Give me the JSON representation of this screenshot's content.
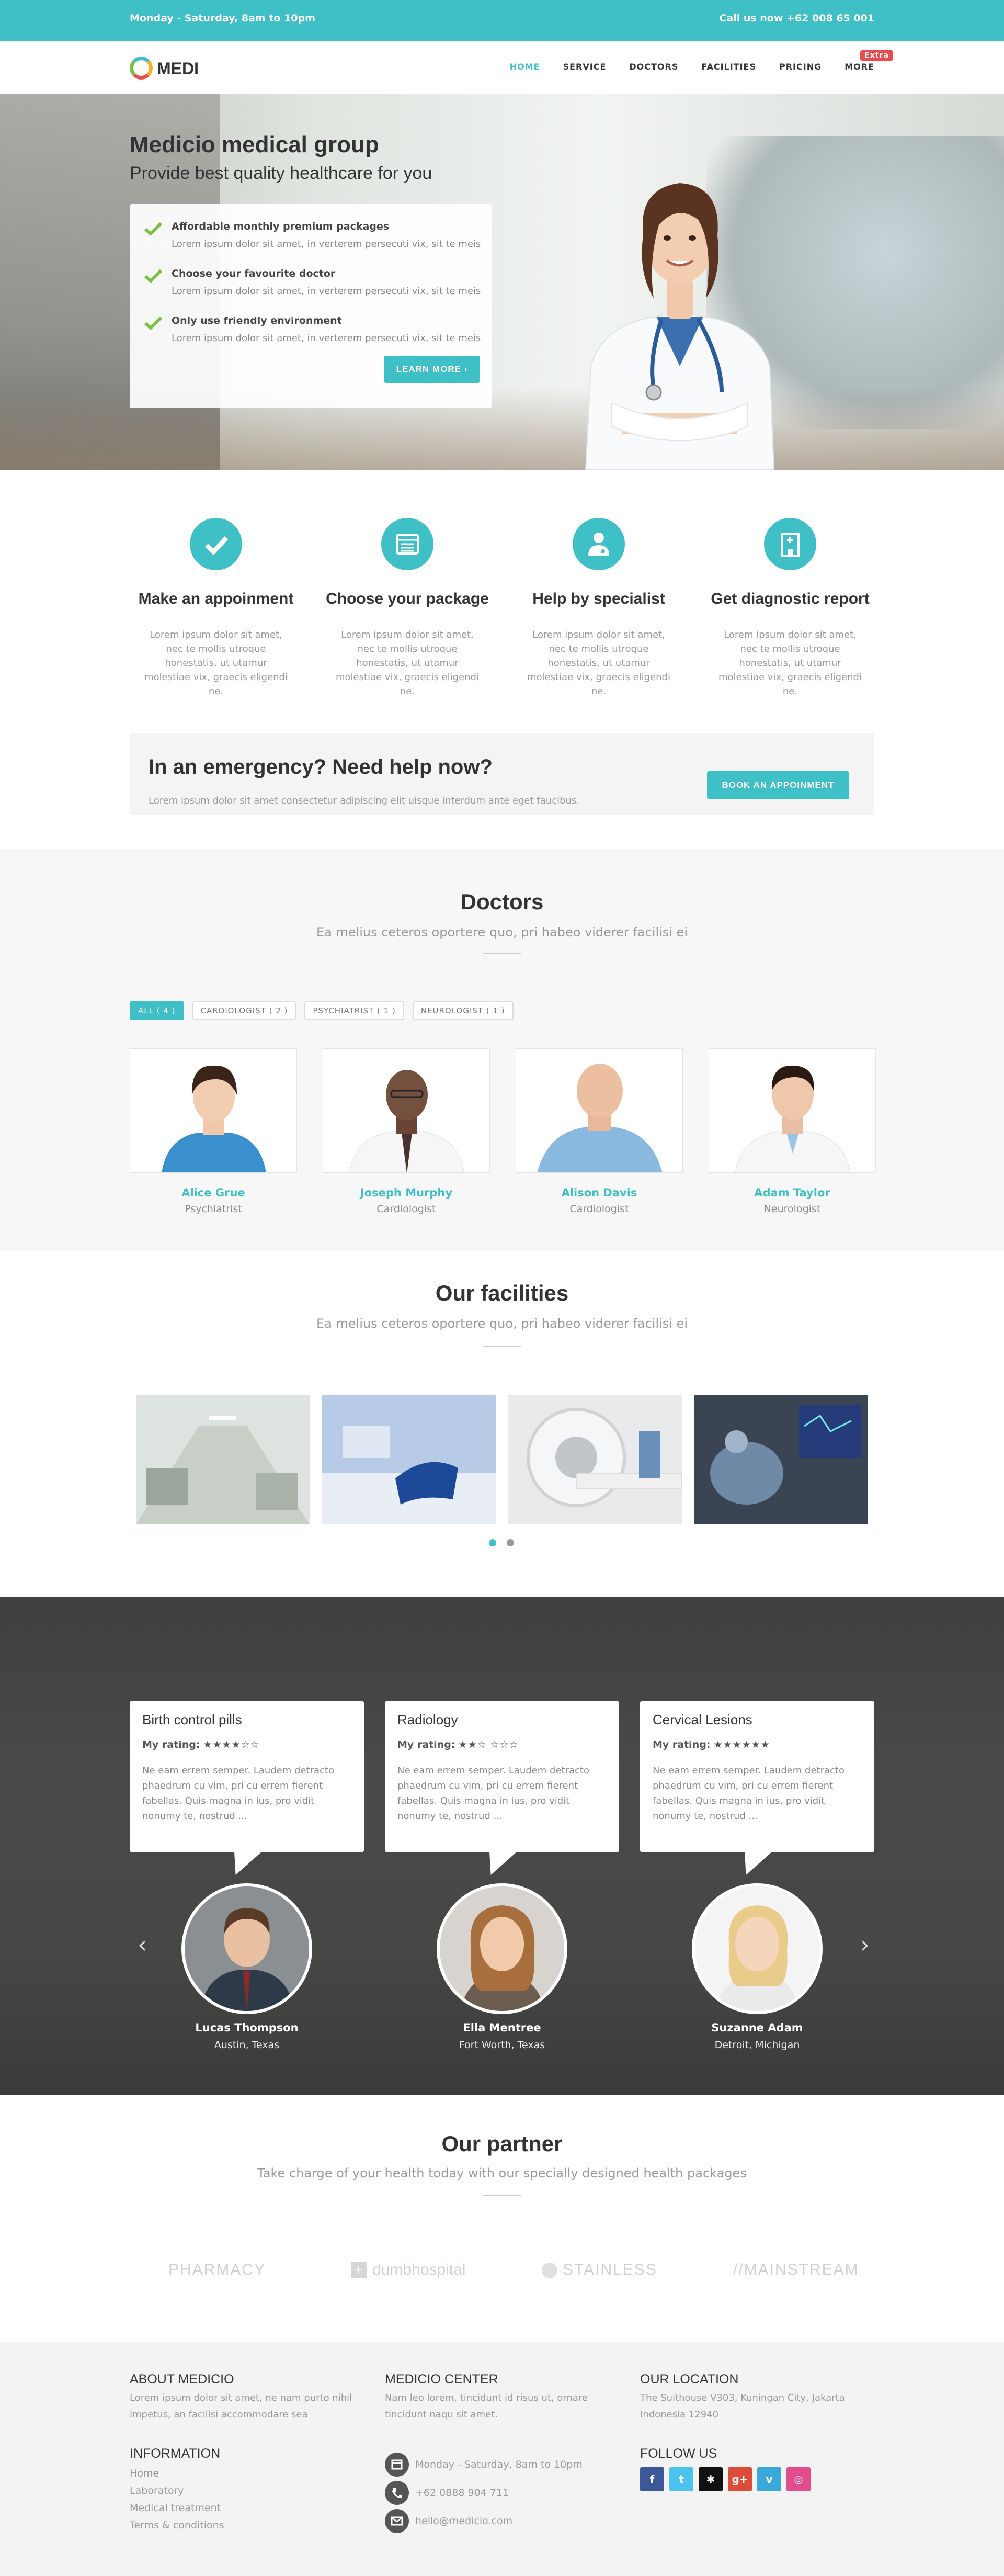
{
  "topbar": {
    "hours": "Monday - Saturday, 8am to 10pm",
    "call": "Call us now +62 008 65 001"
  },
  "nav": {
    "logo": "MEDI",
    "items": [
      "HOME",
      "SERVICE",
      "DOCTORS",
      "FACILITIES",
      "PRICING",
      "MORE"
    ],
    "badge": "Extra"
  },
  "hero": {
    "title": "Medicio medical group",
    "subtitle": "Provide best quality healthcare for you",
    "items": [
      {
        "title": "Affordable monthly premium packages",
        "desc": "Lorem ipsum dolor sit amet, in verterem persecuti vix, sit te meis"
      },
      {
        "title": "Choose your favourite doctor",
        "desc": "Lorem ipsum dolor sit amet, in verterem persecuti vix, sit te meis"
      },
      {
        "title": "Only use friendly environment",
        "desc": "Lorem ipsum dolor sit amet, in verterem persecuti vix, sit te meis"
      }
    ],
    "button": "LEARN MORE ›"
  },
  "features": [
    {
      "icon": "check-icon",
      "title": "Make an appoinment",
      "desc": "Lorem ipsum dolor sit amet, nec te mollis utroque honestatis, ut utamur molestiae vix, graecis eligendi ne."
    },
    {
      "icon": "list-icon",
      "title": "Choose your package",
      "desc": "Lorem ipsum dolor sit amet, nec te mollis utroque honestatis, ut utamur molestiae vix, graecis eligendi ne."
    },
    {
      "icon": "doctor-icon",
      "title": "Help by specialist",
      "desc": "Lorem ipsum dolor sit amet, nec te mollis utroque honestatis, ut utamur molestiae vix, graecis eligendi ne."
    },
    {
      "icon": "hospital-icon",
      "title": "Get diagnostic report",
      "desc": "Lorem ipsum dolor sit amet, nec te mollis utroque honestatis, ut utamur molestiae vix, graecis eligendi ne."
    }
  ],
  "emergency": {
    "title": "In an emergency? Need help now?",
    "desc": "Lorem ipsum dolor sit amet consectetur adipiscing elit uisque interdum ante eget faucibus.",
    "button": "BOOK AN APPOINMENT"
  },
  "doctors": {
    "title": "Doctors",
    "subtitle": "Ea melius ceteros oportere quo, pri habeo viderer facilisi ei",
    "filters": [
      "ALL ( 4 )",
      "CARDIOLOGIST ( 2 )",
      "PSYCHIATRIST ( 1 )",
      "NEUROLOGIST ( 1 )"
    ],
    "list": [
      {
        "name": "Alice Grue",
        "specialty": "Psychiatrist"
      },
      {
        "name": "Joseph Murphy",
        "specialty": "Cardiologist"
      },
      {
        "name": "Alison Davis",
        "specialty": "Cardiologist"
      },
      {
        "name": "Adam Taylor",
        "specialty": "Neurologist"
      }
    ]
  },
  "facilities": {
    "title": "Our facilities",
    "subtitle": "Ea melius ceteros oportere quo, pri habeo viderer facilisi ei"
  },
  "testimonials": [
    {
      "title": "Birth control pills",
      "rating_label": "My rating:",
      "stars": "★★★★☆☆",
      "text": "Ne eam errem semper. Laudem detracto phaedrum cu vim, pri cu errem fierent fabellas. Quis magna in ius, pro vidit nonumy te, nostrud ...",
      "name": "Lucas Thompson",
      "location": "Austin, Texas"
    },
    {
      "title": "Radiology",
      "rating_label": "My rating:",
      "stars": "★★☆ ☆☆☆",
      "text": "Ne eam errem semper. Laudem detracto phaedrum cu vim, pri cu errem fierent fabellas. Quis magna in ius, pro vidit nonumy te, nostrud ...",
      "name": "Ella Mentree",
      "location": "Fort Worth, Texas"
    },
    {
      "title": "Cervical Lesions",
      "rating_label": "My rating:",
      "stars": "★★★★★★",
      "text": "Ne eam errem semper. Laudem detracto phaedrum cu vim, pri cu errem fierent fabellas. Quis magna in ius, pro vidit nonumy te, nostrud ...",
      "name": "Suzanne Adam",
      "location": "Detroit, Michigan"
    }
  ],
  "partner": {
    "title": "Our partner",
    "subtitle": "Take charge of your health today with our specially designed health packages",
    "logos": [
      "PHARMACY",
      "dumbhospital",
      "STAINLESS",
      "//MAINSTREAM"
    ]
  },
  "footer": {
    "about_title": "ABOUT MEDICIO",
    "about_text": "Lorem ipsum dolor sit amet, ne nam purto nihil impetus, an facilisi accommodare sea",
    "info_title": "INFORMATION",
    "info_links": [
      "Home",
      "Laboratory",
      "Medical treatment",
      "Terms & conditions"
    ],
    "center_title": "MEDICIO CENTER",
    "center_text": "Nam leo lorem, tincidunt id risus ut, ornare tincidunt naqu sit amet.",
    "hours": "Monday - Saturday, 8am to 10pm",
    "phone": "+62 0888 904 711",
    "email": "hello@medicio.com",
    "location_title": "OUR LOCATION",
    "location_text": "The Suithouse V303, Kuningan City, Jakarta Indonesia 12940",
    "follow_title": "FOLLOW US",
    "social": [
      "facebook-icon",
      "twitter-icon",
      "github-icon",
      "google-plus-icon",
      "vine-icon",
      "dribbble-icon"
    ]
  },
  "colors": {
    "accent": "#3fbfc6",
    "check": "#7ac142",
    "badge": "#e84d4d"
  }
}
